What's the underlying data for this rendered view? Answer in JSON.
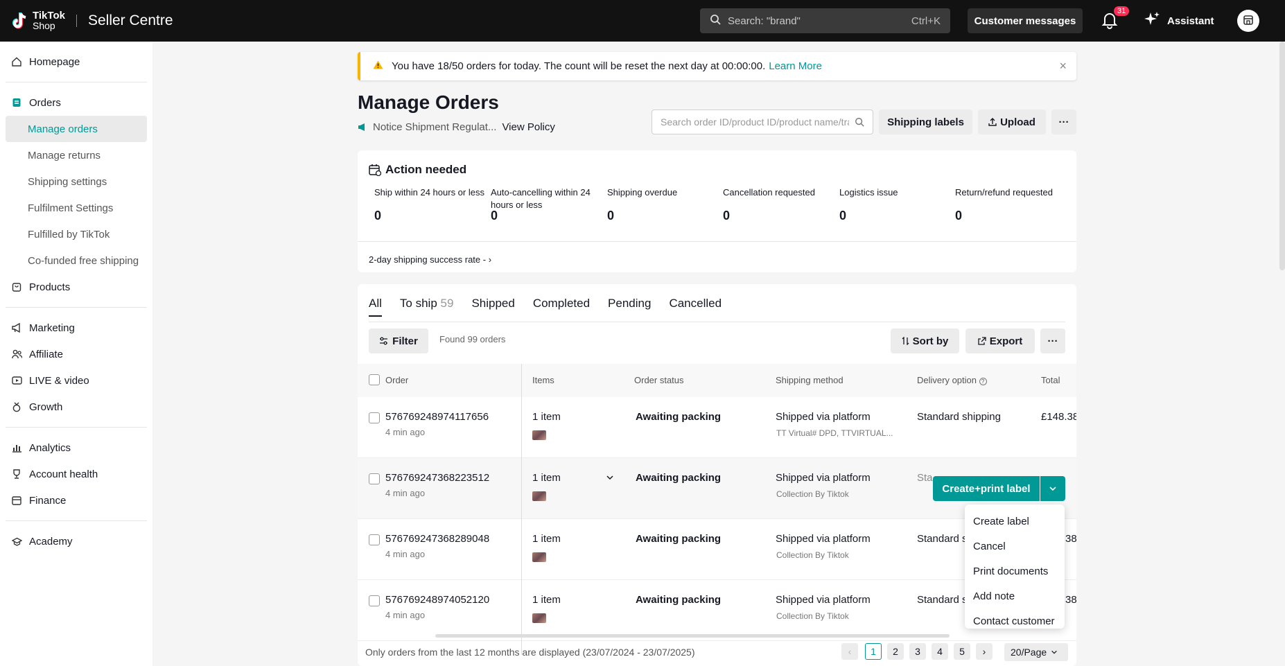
{
  "topbar": {
    "logo_line1": "TikTok",
    "logo_line2": "Shop",
    "title": "Seller Centre",
    "search_placeholder": "Search: \"brand\"",
    "search_shortcut": "Ctrl+K",
    "customer_messages": "Customer messages",
    "notification_count": "31",
    "assistant": "Assistant"
  },
  "sidebar": {
    "homepage": "Homepage",
    "orders": "Orders",
    "orders_sub": [
      "Manage orders",
      "Manage returns",
      "Shipping settings",
      "Fulfilment Settings",
      "Fulfilled by TikTok",
      "Co-funded free shipping"
    ],
    "products": "Products",
    "marketing": "Marketing",
    "affiliate": "Affiliate",
    "live_video": "LIVE & video",
    "growth": "Growth",
    "analytics": "Analytics",
    "account_health": "Account health",
    "finance": "Finance",
    "academy": "Academy"
  },
  "notice": {
    "text": "You have 18/50 orders for today. The count will be reset the next day at 00:00:00.",
    "link": "Learn More"
  },
  "header": {
    "title": "Manage Orders",
    "policy_text": "Notice Shipment Regulat...",
    "policy_link": "View Policy",
    "search_placeholder": "Search order ID/product ID/product name/tracking ID",
    "shipping_labels": "Shipping labels",
    "upload": "Upload",
    "more": "···"
  },
  "action_needed": {
    "title": "Action needed",
    "metrics": [
      {
        "label": "Ship within 24 hours or less",
        "value": "0"
      },
      {
        "label": "Auto-cancelling within 24 hours or less",
        "value": "0"
      },
      {
        "label": "Shipping overdue",
        "value": "0"
      },
      {
        "label": "Cancellation requested",
        "value": "0"
      },
      {
        "label": "Logistics issue",
        "value": "0"
      },
      {
        "label": "Return/refund requested",
        "value": "0"
      }
    ],
    "shipping_rate": "2-day shipping success rate -"
  },
  "tabs": [
    {
      "label": "All",
      "count": ""
    },
    {
      "label": "To ship",
      "count": "59"
    },
    {
      "label": "Shipped",
      "count": ""
    },
    {
      "label": "Completed",
      "count": ""
    },
    {
      "label": "Pending",
      "count": ""
    },
    {
      "label": "Cancelled",
      "count": ""
    }
  ],
  "toolbar": {
    "filter": "Filter",
    "found": "Found 99 orders",
    "sort_by": "Sort by",
    "export": "Export",
    "more": "···"
  },
  "table": {
    "columns": [
      "Order",
      "Items",
      "Order status",
      "Shipping method",
      "Delivery option",
      "Total"
    ],
    "rows": [
      {
        "order_id": "576769248974117656",
        "time": "4 min ago",
        "items": "1 item",
        "status": "Awaiting packing",
        "method": "Shipped via platform",
        "carrier": "TT Virtual# DPD, TTVIRTUAL...",
        "delivery": "Standard shipping",
        "total": "£148.38"
      },
      {
        "order_id": "576769247368223512",
        "time": "4 min ago",
        "items": "1 item",
        "status": "Awaiting packing",
        "method": "Shipped via platform",
        "carrier": "Collection By Tiktok",
        "delivery": "Sta",
        "total": ""
      },
      {
        "order_id": "576769247368289048",
        "time": "4 min ago",
        "items": "1 item",
        "status": "Awaiting packing",
        "method": "Shipped via platform",
        "carrier": "Collection By Tiktok",
        "delivery": "Standard s",
        "total": "38"
      },
      {
        "order_id": "576769248974052120",
        "time": "4 min ago",
        "items": "1 item",
        "status": "Awaiting packing",
        "method": "Shipped via platform",
        "carrier": "Collection By Tiktok",
        "delivery": "Standard s",
        "total": "38"
      }
    ]
  },
  "row_action": {
    "primary": "Create+print label",
    "menu": [
      "Create label",
      "Cancel",
      "Print documents",
      "Add note",
      "Contact customer"
    ]
  },
  "footer": {
    "note": "Only orders from the last 12 months are displayed (23/07/2024 - 23/07/2025)",
    "pages": [
      "1",
      "2",
      "3",
      "4",
      "5"
    ],
    "per_page": "20/Page"
  },
  "colors": {
    "accent": "#009995",
    "topbar": "#121212",
    "badge": "#fe2c55",
    "warning": "#f7b500"
  }
}
